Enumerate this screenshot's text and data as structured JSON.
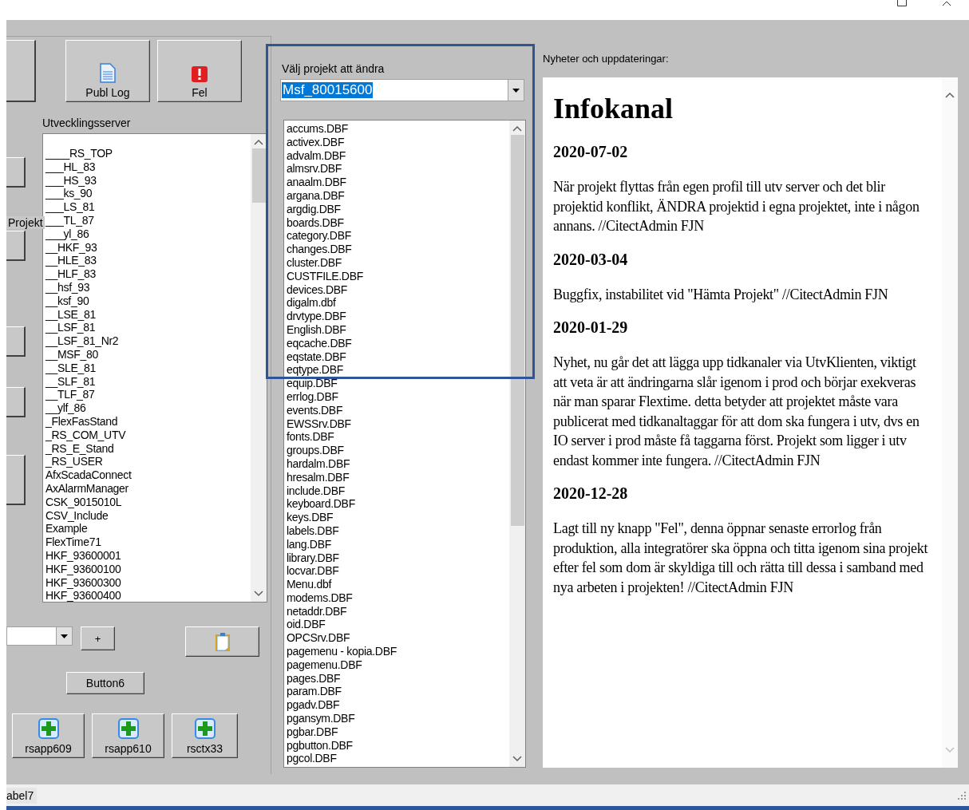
{
  "toolbar": {
    "buttons": [
      {
        "kind": "document",
        "label": "Publ Log"
      },
      {
        "kind": "error",
        "label": "Fel"
      }
    ]
  },
  "side_label": "Projekt",
  "dev_server": {
    "label": "Utvecklingsserver",
    "items": [
      "____RS_TOP",
      "___HL_83",
      "___HS_93",
      "___ks_90",
      "___LS_81",
      "___TL_87",
      "___yl_86",
      "__HKF_93",
      "__HLE_83",
      "__HLF_83",
      "__hsf_93",
      "__ksf_90",
      "__LSE_81",
      "__LSF_81",
      "__LSF_81_Nr2",
      "__MSF_80",
      "__SLE_81",
      "__SLF_81",
      "__TLF_87",
      "__ylf_86",
      "_FlexFasStand",
      "_RS_COM_UTV",
      "_RS_E_Stand",
      "_RS_USER",
      "AfxScadaConnect",
      "AxAlarmManager",
      "CSK_9015010L",
      "CSV_Include",
      "Example",
      "FlexTime71",
      "HKF_93600001",
      "HKF_93600100",
      "HKF_93600300",
      "HKF_93600400"
    ]
  },
  "add_button": "+",
  "button6": "Button6",
  "app_buttons": [
    "rsapp609",
    "rsapp610",
    "rsctx33"
  ],
  "project_picker": {
    "label": "Välj projekt att ändra",
    "value": "Msf_80015600",
    "files": [
      "accums.DBF",
      "activex.DBF",
      "advalm.DBF",
      "almsrv.DBF",
      "anaalm.DBF",
      "argana.DBF",
      "argdig.DBF",
      "boards.DBF",
      "category.DBF",
      "changes.DBF",
      "cluster.DBF",
      "CUSTFILE.DBF",
      "devices.DBF",
      "digalm.dbf",
      "drvtype.DBF",
      "English.DBF",
      "eqcache.DBF",
      "eqstate.DBF",
      "eqtype.DBF",
      "equip.DBF",
      "errlog.DBF",
      "events.DBF",
      "EWSSrv.DBF",
      "fonts.DBF",
      "groups.DBF",
      "hardalm.DBF",
      "hresalm.DBF",
      "include.DBF",
      "keyboard.DBF",
      "keys.DBF",
      "labels.DBF",
      "lang.DBF",
      "library.DBF",
      "locvar.DBF",
      "Menu.dbf",
      "modems.DBF",
      "netaddr.DBF",
      "oid.DBF",
      "OPCSrv.DBF",
      "pagemenu - kopia.DBF",
      "pagemenu.DBF",
      "pages.DBF",
      "param.DBF",
      "pgadv.DBF",
      "pgansym.DBF",
      "pgbar.DBF",
      "pgbutton.DBF",
      "pgcol.DBF"
    ]
  },
  "news": {
    "label": "Nyheter och uppdateringar:",
    "title": "Infokanal",
    "entries": [
      {
        "date": "2020-07-02",
        "text": "När projekt flyttas från egen profil till utv server och det blir projektid konflikt, ÄNDRA projektid i egna projektet, inte i någon annans. //CitectAdmin FJN"
      },
      {
        "date": "2020-03-04",
        "text": "Buggfix, instabilitet vid \"Hämta Projekt\" //CitectAdmin FJN"
      },
      {
        "date": "2020-01-29",
        "text": "Nyhet, nu går det att lägga upp tidkanaler via UtvKlienten, viktigt att veta är att ändringarna slår igenom i prod och börjar exekveras när man sparar Flextime. detta betyder att projektet måste vara publicerat med tidkanaltaggar för att dom ska fungera i utv, dvs en IO server i prod måste få taggarna först. Projekt som ligger i utv endast kommer inte fungera. //CitectAdmin FJN"
      },
      {
        "date": "2020-12-28",
        "text": "Lagt till ny knapp \"Fel\", denna öppnar senaste errorlog från produktion, alla integratörer ska öppna och titta igenom sina projekt efter fel som dom är skyldiga till och rätta till dessa i samband med nya arbeten i projekten! //CitectAdmin FJN"
      }
    ]
  },
  "status_bar": {
    "label": "abel7"
  }
}
